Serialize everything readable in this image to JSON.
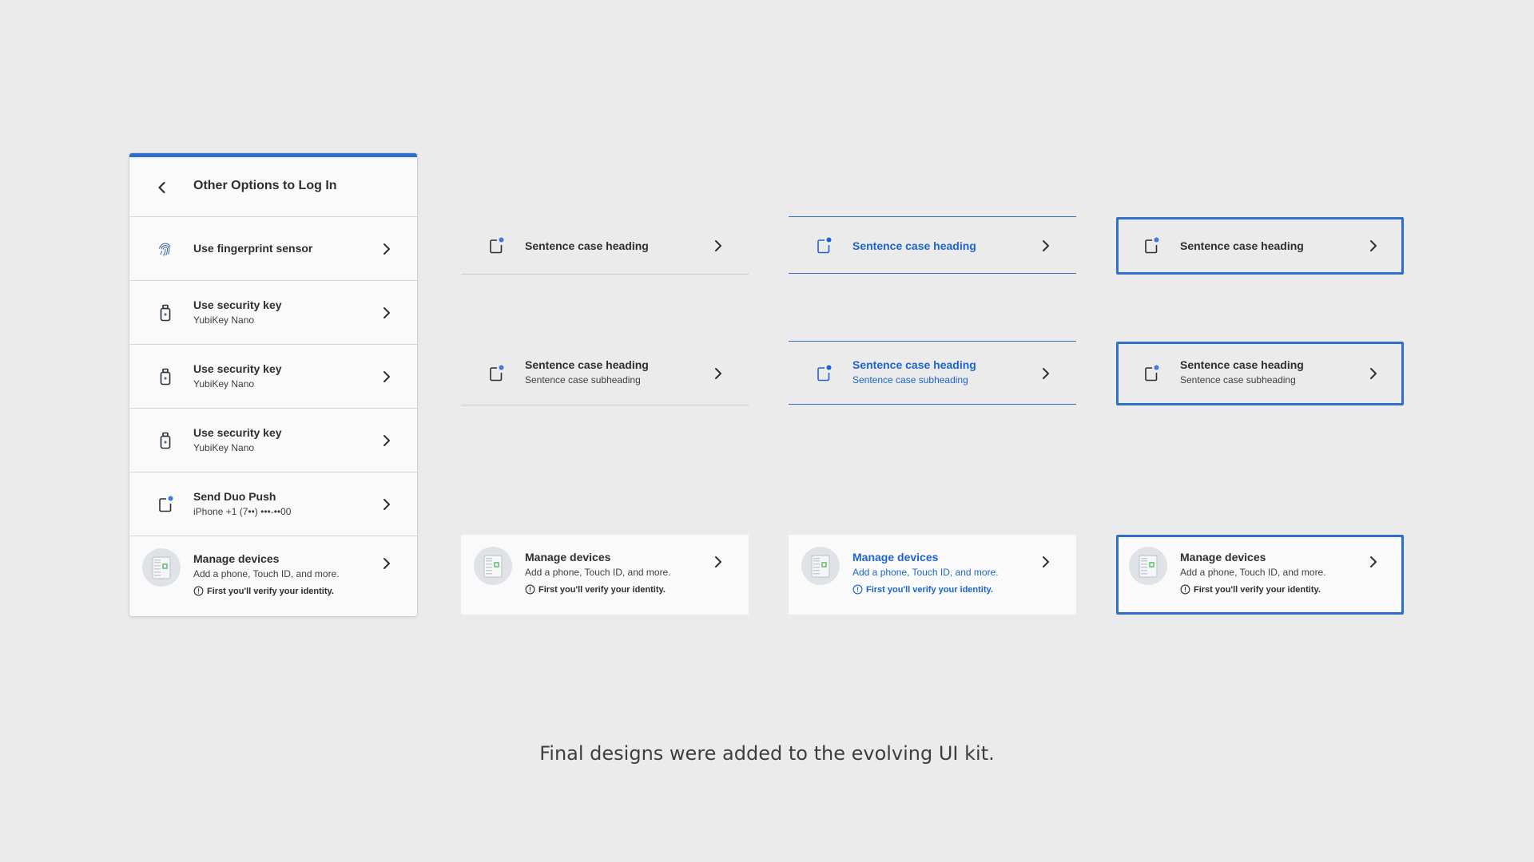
{
  "colors": {
    "accent": "#2f6fcc",
    "link_text": "#1d63d1",
    "text": "#2b2f33",
    "background": "#ebebeb"
  },
  "panel": {
    "title": "Other Options to Log In",
    "items": [
      {
        "title": "Use fingerprint sensor",
        "icon": "fingerprint-icon"
      },
      {
        "title": "Use security key",
        "subtitle": "YubiKey Nano",
        "icon": "security-key-icon"
      },
      {
        "title": "Use security key",
        "subtitle": "YubiKey Nano",
        "icon": "security-key-icon"
      },
      {
        "title": "Use security key",
        "subtitle": "YubiKey Nano",
        "icon": "security-key-icon"
      },
      {
        "title": "Send Duo Push",
        "subtitle": "iPhone +1 (7••) •••-••00",
        "icon": "phone-push-icon"
      }
    ],
    "manage": {
      "title": "Manage devices",
      "subtitle": "Add a phone, Touch ID, and more.",
      "note": "First you'll verify your identity."
    }
  },
  "variants": {
    "heading": "Sentence case heading",
    "subheading": "Sentence case subheading",
    "manage_title": "Manage devices",
    "manage_subtitle": "Add a phone, Touch ID, and more.",
    "manage_note": "First you'll verify your identity."
  },
  "caption": "Final designs were added to the evolving UI kit."
}
